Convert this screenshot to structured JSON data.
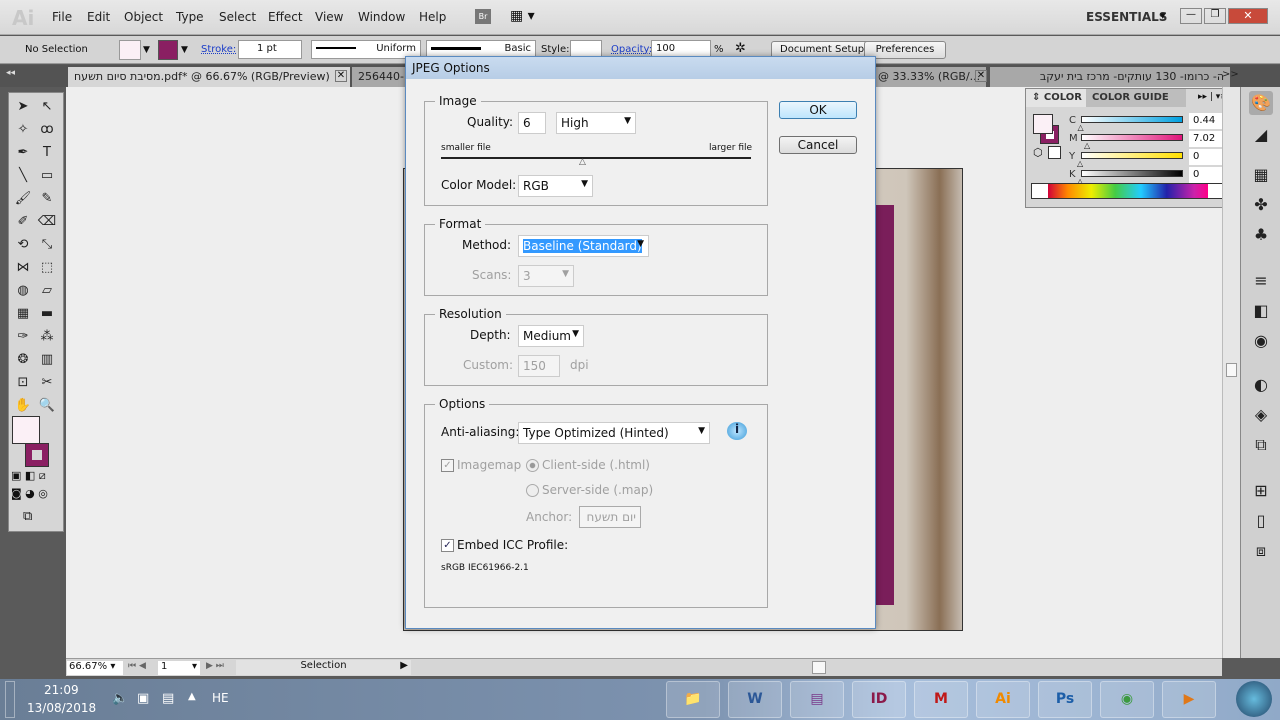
{
  "app": {
    "logo": "Ai",
    "menu": [
      "File",
      "Edit",
      "Object",
      "Type",
      "Select",
      "Effect",
      "View",
      "Window",
      "Help"
    ],
    "bridge": "Br",
    "workspace": "ESSENTIALS"
  },
  "control": {
    "selection": "No Selection",
    "stroke_label": "Stroke:",
    "stroke_value": "1 pt",
    "profile": "Uniform",
    "brush": "Basic",
    "style_label": "Style:",
    "opacity_label": "Opacity:",
    "opacity_value": "100",
    "percent": "%",
    "document_setup": "Document Setup",
    "preferences": "Preferences"
  },
  "tabs": [
    {
      "label": "מסיבת סיום תשעח.pdf* @ 66.67% (RGB/Preview)",
      "active": true
    },
    {
      "label": "256440-F",
      "active": false
    },
    {
      "label": "@ 33.33% (RGB/...",
      "active": false
    },
    {
      "label": "ה- כרומו- 130 עותקים- מרכז בית יעקב",
      "active": false
    }
  ],
  "tabs_overflow": ">>",
  "colorpanel": {
    "tabs": [
      "COLOR",
      "COLOR GUIDE"
    ],
    "channels": [
      {
        "label": "C",
        "value": "0.44",
        "percent": 0.44,
        "color": "#00a0e0"
      },
      {
        "label": "M",
        "value": "7.02",
        "percent": 7.02,
        "color": "#e0157a"
      },
      {
        "label": "Y",
        "value": "0",
        "percent": 0,
        "color": "#ffe000"
      },
      {
        "label": "K",
        "value": "0",
        "percent": 0,
        "color": "#000000"
      }
    ],
    "pct": "%",
    "fill": "#fbf0f6",
    "stroke": "#8a1f62"
  },
  "status": {
    "zoom": "66.67%",
    "page": "1",
    "tool": "Selection"
  },
  "taskbar": {
    "time": "21:09",
    "date": "13/08/2018",
    "lang": "HE",
    "apps": [
      "file-explorer",
      "word",
      "winrar",
      "indesign",
      "mcafee",
      "illustrator",
      "photoshop",
      "chrome",
      "media-player"
    ]
  },
  "dialog": {
    "title": "JPEG Options",
    "ok": "OK",
    "cancel": "Cancel",
    "image": {
      "legend": "Image",
      "quality_label": "Quality:",
      "quality_value": "6",
      "quality_preset": "High",
      "smaller": "smaller file",
      "larger": "larger file",
      "quality_level": 0.6,
      "color_model_label": "Color Model:",
      "color_model": "RGB"
    },
    "format": {
      "legend": "Format",
      "method_label": "Method:",
      "method": "Baseline (Standard)",
      "scans_label": "Scans:",
      "scans": "3"
    },
    "resolution": {
      "legend": "Resolution",
      "depth_label": "Depth:",
      "depth": "Medium",
      "custom_label": "Custom:",
      "custom": "150",
      "unit": "dpi"
    },
    "options": {
      "legend": "Options",
      "aa_label": "Anti-aliasing:",
      "aa": "Type Optimized (Hinted)",
      "imagemap": "Imagemap",
      "client": "Client-side (.html)",
      "server": "Server-side (.map)",
      "anchor_label": "Anchor:",
      "anchor": "יום תשעח",
      "embed": "Embed ICC Profile:",
      "profile": "sRGB IEC61966-2.1"
    }
  }
}
